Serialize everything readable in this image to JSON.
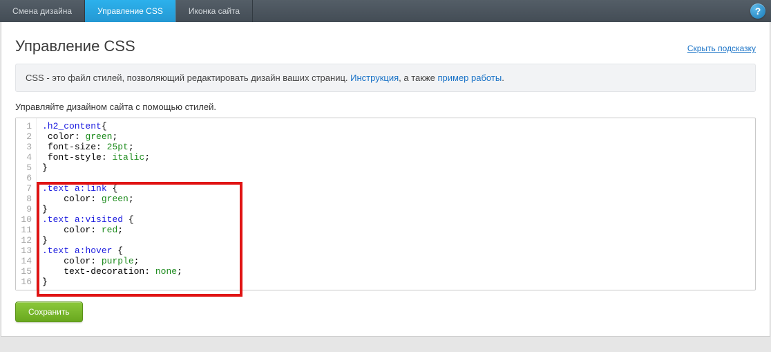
{
  "tabs": [
    {
      "label": "Смена дизайна",
      "active": false
    },
    {
      "label": "Управление CSS",
      "active": true
    },
    {
      "label": "Иконка сайта",
      "active": false
    }
  ],
  "help_char": "?",
  "page_title": "Управление CSS",
  "hint_link": "Скрыть подсказку",
  "info": {
    "prefix": "CSS - это файл стилей, позволяющий редактировать дизайн ваших страниц. ",
    "link1": "Инструкция",
    "mid": ", а также ",
    "link2": "пример работы",
    "suffix": "."
  },
  "subtitle": "Управляйте дизайном сайта с помощью стилей.",
  "code_lines": [
    [
      {
        "t": "sel",
        "v": ".h2_content"
      },
      {
        "t": "punc",
        "v": "{"
      }
    ],
    [
      {
        "t": "pad",
        "v": " "
      },
      {
        "t": "prop",
        "v": "color"
      },
      {
        "t": "punc",
        "v": ": "
      },
      {
        "t": "val",
        "v": "green"
      },
      {
        "t": "punc",
        "v": ";"
      }
    ],
    [
      {
        "t": "pad",
        "v": " "
      },
      {
        "t": "prop",
        "v": "font-size"
      },
      {
        "t": "punc",
        "v": ": "
      },
      {
        "t": "val",
        "v": "25pt"
      },
      {
        "t": "punc",
        "v": ";"
      }
    ],
    [
      {
        "t": "pad",
        "v": " "
      },
      {
        "t": "prop",
        "v": "font-style"
      },
      {
        "t": "punc",
        "v": ": "
      },
      {
        "t": "val",
        "v": "italic"
      },
      {
        "t": "punc",
        "v": ";"
      }
    ],
    [
      {
        "t": "punc",
        "v": "}"
      }
    ],
    [],
    [
      {
        "t": "sel",
        "v": ".text"
      },
      {
        "t": "punc",
        "v": " "
      },
      {
        "t": "sel",
        "v": "a"
      },
      {
        "t": "pseudo",
        "v": ":link"
      },
      {
        "t": "punc",
        "v": " {"
      }
    ],
    [
      {
        "t": "pad",
        "v": "    "
      },
      {
        "t": "prop",
        "v": "color"
      },
      {
        "t": "punc",
        "v": ": "
      },
      {
        "t": "val",
        "v": "green"
      },
      {
        "t": "punc",
        "v": ";"
      }
    ],
    [
      {
        "t": "punc",
        "v": "}"
      }
    ],
    [
      {
        "t": "sel",
        "v": ".text"
      },
      {
        "t": "punc",
        "v": " "
      },
      {
        "t": "sel",
        "v": "a"
      },
      {
        "t": "pseudo",
        "v": ":visited"
      },
      {
        "t": "punc",
        "v": " {"
      }
    ],
    [
      {
        "t": "pad",
        "v": "    "
      },
      {
        "t": "prop",
        "v": "color"
      },
      {
        "t": "punc",
        "v": ": "
      },
      {
        "t": "val",
        "v": "red"
      },
      {
        "t": "punc",
        "v": ";"
      }
    ],
    [
      {
        "t": "punc",
        "v": "}"
      }
    ],
    [
      {
        "t": "sel",
        "v": ".text"
      },
      {
        "t": "punc",
        "v": " "
      },
      {
        "t": "sel",
        "v": "a"
      },
      {
        "t": "pseudo",
        "v": ":hover"
      },
      {
        "t": "punc",
        "v": " {"
      }
    ],
    [
      {
        "t": "pad",
        "v": "    "
      },
      {
        "t": "prop",
        "v": "color"
      },
      {
        "t": "punc",
        "v": ": "
      },
      {
        "t": "val",
        "v": "purple"
      },
      {
        "t": "punc",
        "v": ";"
      }
    ],
    [
      {
        "t": "pad",
        "v": "    "
      },
      {
        "t": "prop",
        "v": "text-decoration"
      },
      {
        "t": "punc",
        "v": ": "
      },
      {
        "t": "val",
        "v": "none"
      },
      {
        "t": "punc",
        "v": ";"
      }
    ],
    [
      {
        "t": "punc",
        "v": "}"
      }
    ]
  ],
  "save_label": "Сохранить"
}
